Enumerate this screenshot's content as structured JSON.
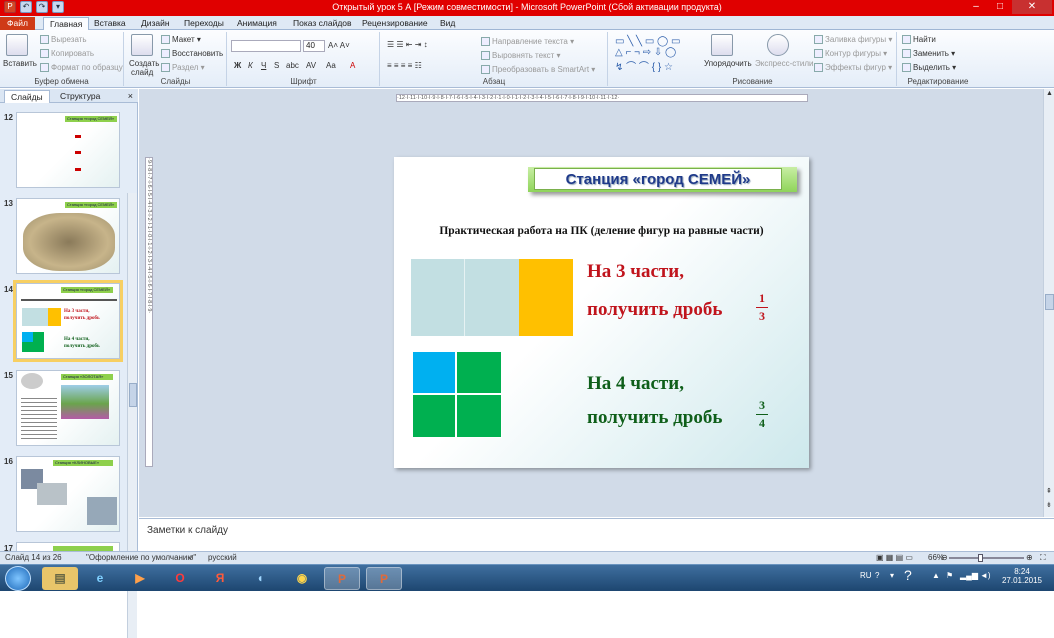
{
  "window": {
    "title": "Открытый урок  5 А [Режим совместимости]  -  Microsoft PowerPoint (Сбой активации продукта)"
  },
  "tabs": [
    {
      "label": "Файл"
    },
    {
      "label": "Главная"
    },
    {
      "label": "Вставка"
    },
    {
      "label": "Дизайн"
    },
    {
      "label": "Переходы"
    },
    {
      "label": "Анимация"
    },
    {
      "label": "Показ слайдов"
    },
    {
      "label": "Рецензирование"
    },
    {
      "label": "Вид"
    }
  ],
  "ribbon": {
    "clipboard": {
      "paste": "Вставить",
      "cut": "Вырезать",
      "copy": "Копировать",
      "format": "Формат по образцу",
      "label": "Буфер обмена"
    },
    "slides": {
      "create": "Создать",
      "create2": "слайд",
      "layout": "Макет",
      "reset": "Восстановить",
      "section": "Раздел",
      "label": "Слайды"
    },
    "font": {
      "size": "40",
      "label": "Шрифт"
    },
    "paragraph": {
      "text_dir": "Направление текста",
      "align": "Выровнять текст",
      "smartart": "Преобразовать в SmartArt",
      "label": "Абзац"
    },
    "drawing": {
      "arrange": "Упорядочить",
      "styles": "Экспресс-стили",
      "fill": "Заливка фигуры",
      "outline": "Контур фигуры",
      "effects": "Эффекты фигур",
      "label": "Рисование"
    },
    "editing": {
      "find": "Найти",
      "replace": "Заменить",
      "select": "Выделить",
      "label": "Редактирование"
    }
  },
  "panel": {
    "tab_slides": "Слайды",
    "tab_outline": "Структура",
    "close": "×"
  },
  "thumbnails": [
    {
      "num": "12",
      "banner": "Станция «город СЕМЕЙ»"
    },
    {
      "num": "13",
      "banner": "Станция «город СЕМЕЙ»"
    },
    {
      "num": "14",
      "banner": "Станция «город СЕМЕЙ»",
      "t1": "На 3 части,",
      "t2": "получить дробь",
      "t3": "На 4 части,",
      "t4": "получить дробь"
    },
    {
      "num": "15",
      "banner": "Станция «ЗОЛОТАЯ»"
    },
    {
      "num": "16",
      "banner": "Станция «КЛИНОВЫЕ»"
    },
    {
      "num": "17"
    }
  ],
  "ruler": {
    "h": "·12·I·11·I·10·I·9·I·8·I·7·I·6·I·5·I·4·I·3·I·2·I·1·I·0·I·1·I·2·I·3·I·4·I·5·I·6·I·7·I·8·I·9·I·10·I·11·I·12·",
    "v": "·9·I·8·I·7·I·6·I·5·I·4·I·3·I·2·I·1·I·0·I·1·I·2·I·3·I·4·I·5·I·6·I·7·I·8·I·9·"
  },
  "slide": {
    "banner": "Станция  «город СЕМЕЙ»",
    "subtitle": "Практическая работа на ПК (деление фигур на равные части)",
    "part1": {
      "line1": "На 3 части,",
      "line2": "получить дробь",
      "num": "1",
      "den": "3"
    },
    "part2": {
      "line1": "На 4 части,",
      "line2": "получить дробь",
      "num": "3",
      "den": "4"
    },
    "colors": {
      "red": "#c0141c",
      "green": "#0f5f1a",
      "lightcell": "#c2dfe2",
      "yellow": "#ffc000",
      "blue": "#00b0f0",
      "green_cell": "#00b050"
    }
  },
  "notes": {
    "placeholder": "Заметки к слайду"
  },
  "status": {
    "slide": "Слайд 14 из 26",
    "theme": "\"Оформление по умолчанию\"",
    "lang": "русский",
    "zoom": "66%"
  },
  "taskbar": {
    "lang": "RU",
    "time": "8:24",
    "date": "27.01.2015"
  }
}
